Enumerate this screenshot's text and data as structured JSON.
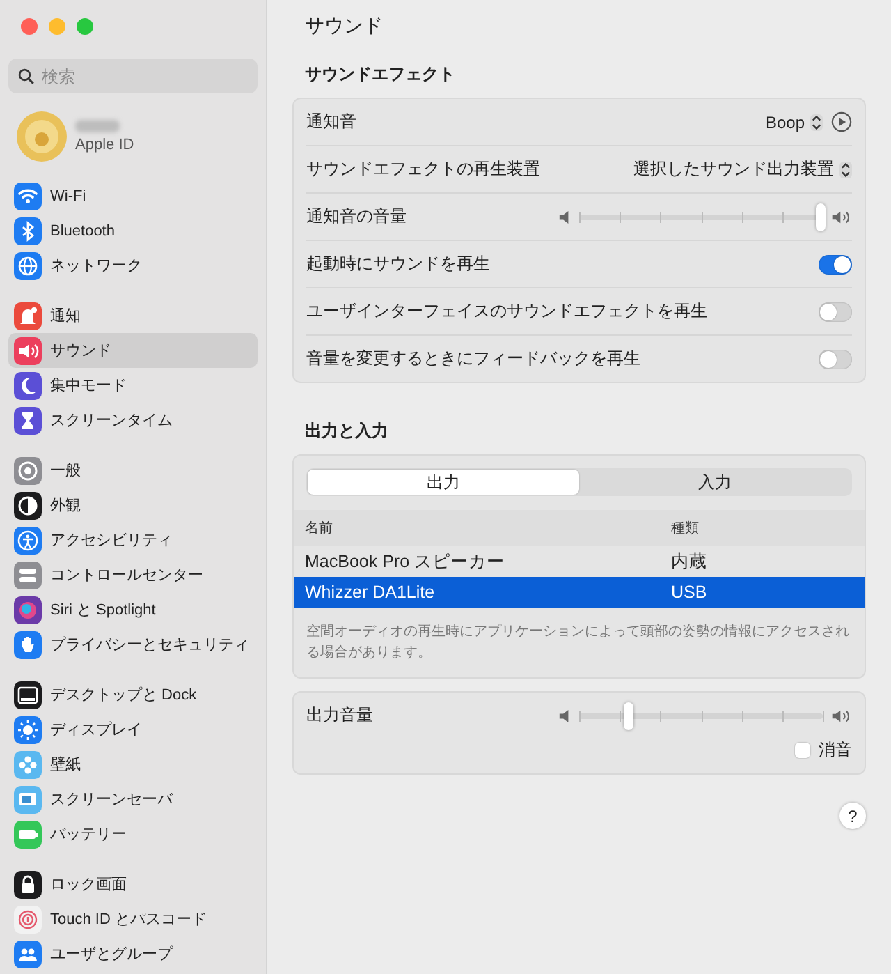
{
  "sidebar": {
    "search": {
      "placeholder": "検索"
    },
    "account": {
      "subtitle": "Apple ID"
    },
    "groups": [
      [
        {
          "label": "Wi-Fi",
          "color": "#1e7cf2",
          "selected": false
        },
        {
          "label": "Bluetooth",
          "color": "#1e7cf2",
          "selected": false
        },
        {
          "label": "ネットワーク",
          "color": "#1e7cf2",
          "selected": false
        }
      ],
      [
        {
          "label": "通知",
          "color": "#eb4a3c",
          "selected": false
        },
        {
          "label": "サウンド",
          "color": "#ec3f5d",
          "selected": true
        },
        {
          "label": "集中モード",
          "color": "#5b4fd6",
          "selected": false
        },
        {
          "label": "スクリーンタイム",
          "color": "#5b4fd6",
          "selected": false
        }
      ],
      [
        {
          "label": "一般",
          "color": "#8e8e93",
          "selected": false
        },
        {
          "label": "外観",
          "color": "#1c1c1e",
          "selected": false
        },
        {
          "label": "アクセシビリティ",
          "color": "#1e7cf2",
          "selected": false
        },
        {
          "label": "コントロールセンター",
          "color": "#8e8e93",
          "selected": false
        },
        {
          "label": "Siri と Spotlight",
          "color": "#6b3aa8",
          "selected": false
        },
        {
          "label": "プライバシーとセキュリティ",
          "color": "#1e7cf2",
          "selected": false
        }
      ],
      [
        {
          "label": "デスクトップと Dock",
          "color": "#1c1c1e",
          "selected": false
        },
        {
          "label": "ディスプレイ",
          "color": "#1e7cf2",
          "selected": false
        },
        {
          "label": "壁紙",
          "color": "#5ab8f0",
          "selected": false
        },
        {
          "label": "スクリーンセーバ",
          "color": "#5ab8f0",
          "selected": false
        },
        {
          "label": "バッテリー",
          "color": "#34c759",
          "selected": false
        }
      ],
      [
        {
          "label": "ロック画面",
          "color": "#1c1c1e",
          "selected": false
        },
        {
          "label": "Touch ID とパスコード",
          "color": "#f2f2f2",
          "selected": false
        },
        {
          "label": "ユーザとグループ",
          "color": "#1e7cf2",
          "selected": false
        }
      ]
    ]
  },
  "title": "サウンド",
  "sound_effects": {
    "heading": "サウンドエフェクト",
    "rows": [
      {
        "kind": "popup",
        "label": "通知音",
        "value": "Boop",
        "play_button": true
      },
      {
        "kind": "popup",
        "label": "サウンドエフェクトの再生装置",
        "value": "選択したサウンド出力装置",
        "play_button": false
      },
      {
        "kind": "slider",
        "label": "通知音の音量",
        "level": 0.99
      },
      {
        "kind": "toggle",
        "label": "起動時にサウンドを再生",
        "on": true
      },
      {
        "kind": "toggle",
        "label": "ユーザインターフェイスのサウンドエフェクトを再生",
        "on": false
      },
      {
        "kind": "toggle",
        "label": "音量を変更するときにフィードバックを再生",
        "on": false
      }
    ]
  },
  "output_input": {
    "heading": "出力と入力",
    "tabs": [
      {
        "label": "出力",
        "selected": true
      },
      {
        "label": "入力",
        "selected": false
      }
    ],
    "columns": [
      "名前",
      "種類"
    ],
    "rows": [
      {
        "name": "MacBook Pro スピーカー",
        "type": "内蔵",
        "selected": false
      },
      {
        "name": "Whizzer DA1Lite",
        "type": "USB",
        "selected": true
      }
    ],
    "note": "空間オーディオの再生時にアプリケーションによって頭部の姿勢の情報にアクセスされる場合があります。"
  },
  "output_volume": {
    "label": "出力音量",
    "level": 0.2,
    "mute": {
      "label": "消音",
      "checked": false
    }
  },
  "help": "?"
}
